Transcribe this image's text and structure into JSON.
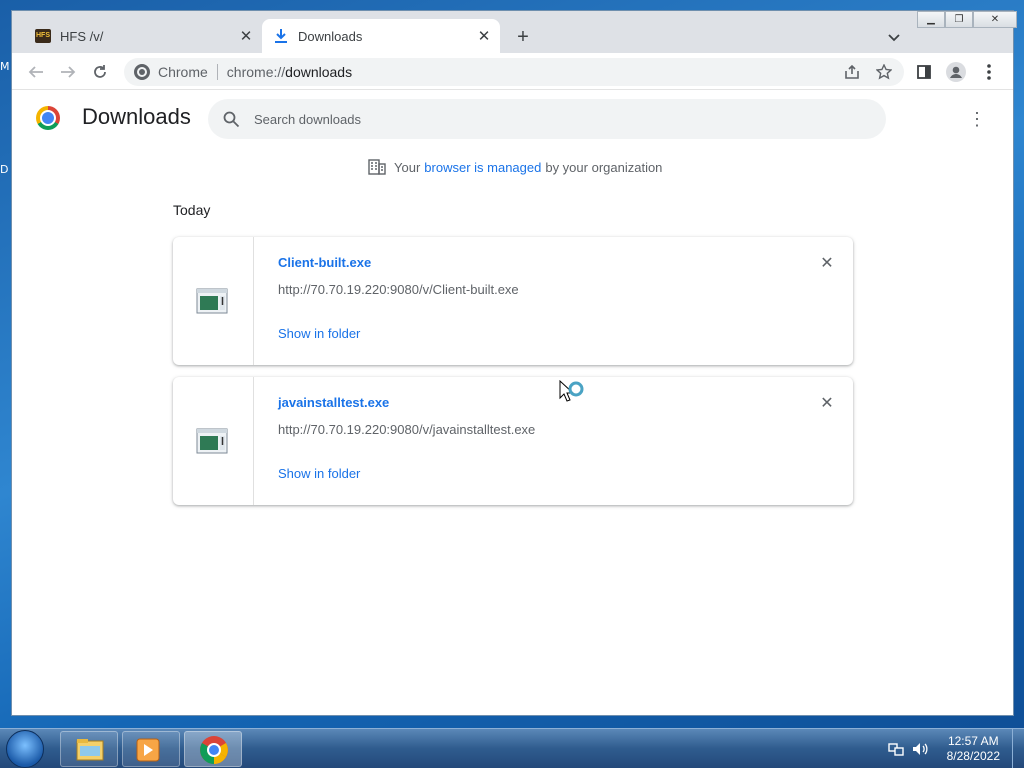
{
  "browser": {
    "tabs": [
      {
        "title": "HFS /v/",
        "favicon": "hfs-icon",
        "active": false
      },
      {
        "title": "Downloads",
        "favicon": "download-icon",
        "active": true
      }
    ],
    "omnibox": {
      "site_label": "Chrome",
      "url_scheme": "chrome://",
      "url_path": "downloads"
    }
  },
  "desktop": {
    "edge_labels": [
      "M",
      "D"
    ]
  },
  "page": {
    "title": "Downloads",
    "search_placeholder": "Search downloads",
    "managed": {
      "prefix": "Your",
      "link": "browser is managed",
      "suffix": "by your organization"
    },
    "date_header": "Today",
    "downloads": [
      {
        "filename": "Client-built.exe",
        "url": "http://70.70.19.220:9080/v/Client-built.exe",
        "action": "Show in folder"
      },
      {
        "filename": "javainstalltest.exe",
        "url": "http://70.70.19.220:9080/v/javainstalltest.exe",
        "action": "Show in folder"
      }
    ]
  },
  "taskbar": {
    "pinned": [
      "explorer-icon",
      "media-player-icon",
      "chrome-icon"
    ],
    "clock": {
      "time": "12:57 AM",
      "date": "8/28/2022"
    }
  },
  "colors": {
    "accent": "#1a73e8",
    "tabstrip": "#dee1e6",
    "desktop": "#1e6fb8"
  }
}
